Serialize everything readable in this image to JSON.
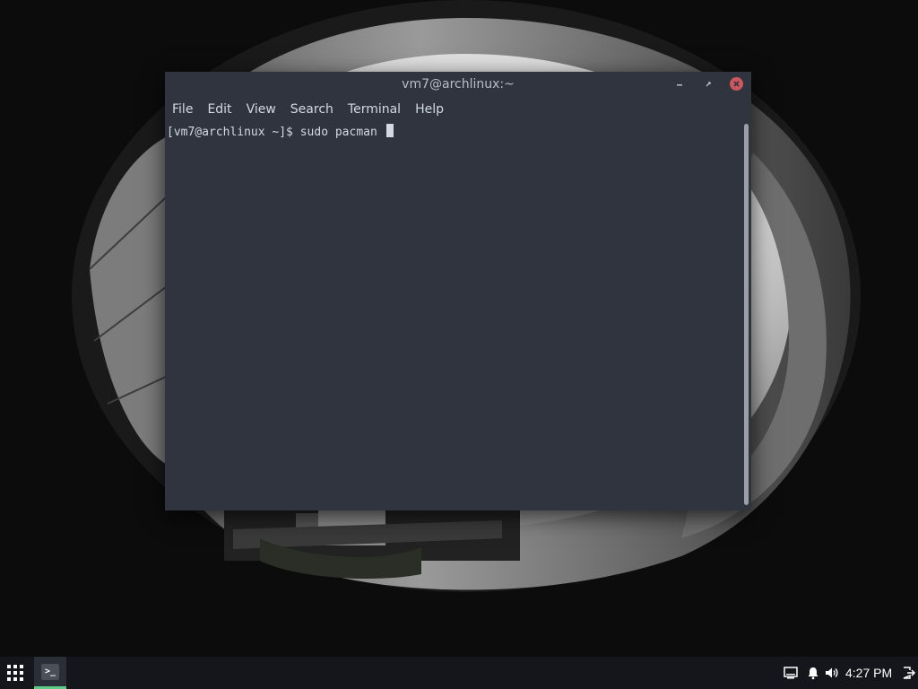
{
  "window": {
    "title": "vm7@archlinux:~",
    "controls": {
      "minimize_icon": "minimize-icon",
      "maximize_icon": "maximize-icon",
      "close_icon": "close-icon"
    }
  },
  "menubar": {
    "items": [
      "File",
      "Edit",
      "View",
      "Search",
      "Terminal",
      "Help"
    ]
  },
  "terminal": {
    "prompt": "[vm7@archlinux ~]$ ",
    "command": "sudo pacman "
  },
  "taskbar": {
    "apps_icon": "apps-grid-icon",
    "task_icon_glyph": ">_",
    "tray": [
      "display-icon",
      "bell-icon",
      "volume-icon"
    ],
    "clock": "4:27 PM",
    "exit_icon": "logout-icon"
  },
  "colors": {
    "window_bg": "#2f343f",
    "text": "#d3dae3",
    "close_button": "#cc575d",
    "active_task_indicator": "#5bcc85",
    "taskbar_bg": "#14161b"
  }
}
